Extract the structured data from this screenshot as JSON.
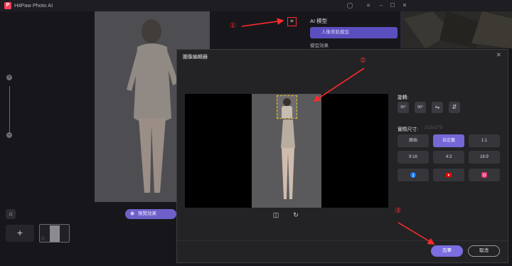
{
  "window": {
    "title": "HitPaw Photo AI"
  },
  "right_panel": {
    "title": "AI 模型",
    "selected_model": "人像美肌模型",
    "sub_label": "模型效果"
  },
  "canvas": {
    "preview_label": "預覽效果"
  },
  "modal": {
    "title": "圖像編輯器",
    "rotate_label": "旋轉:",
    "rotate_buttons": [
      "90°",
      "90°",
      "",
      ""
    ],
    "size_label": "實際尺寸:",
    "size_value": "212x275",
    "ratios": [
      {
        "label": "原始",
        "active": false
      },
      {
        "label": "自定義",
        "active": true
      },
      {
        "label": "1:1",
        "active": false
      },
      {
        "label": "9:16",
        "active": false
      },
      {
        "label": "4:3",
        "active": false
      },
      {
        "label": "16:9",
        "active": false
      }
    ],
    "social": [
      "facebook-icon",
      "youtube-icon",
      "instagram-icon"
    ],
    "done_label": "完畢",
    "cancel_label": "取消"
  },
  "annotations": [
    "①",
    "②",
    "③"
  ],
  "colors": {
    "accent": "#7468d6",
    "annotation": "#ff2b2b",
    "crop_box": "#f0c419"
  }
}
